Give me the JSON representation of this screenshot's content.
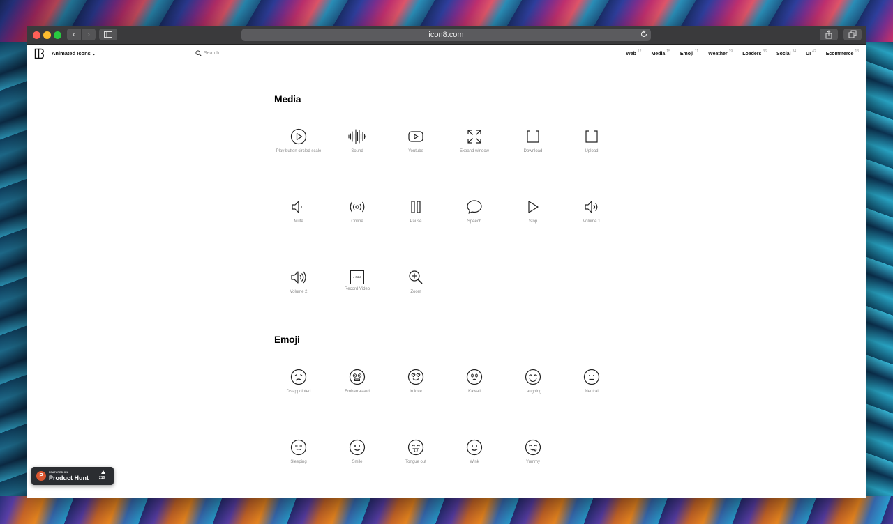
{
  "browser": {
    "url": "icon8.com"
  },
  "header": {
    "brand": "Animated Icons",
    "search_placeholder": "Search...",
    "categories": [
      {
        "label": "Web",
        "count": "12"
      },
      {
        "label": "Media",
        "count": "15"
      },
      {
        "label": "Emoji",
        "count": "11"
      },
      {
        "label": "Weather",
        "count": "19"
      },
      {
        "label": "Loaders",
        "count": "36"
      },
      {
        "label": "Social",
        "count": "34"
      },
      {
        "label": "UI",
        "count": "42"
      },
      {
        "label": "Ecommerce",
        "count": "13"
      }
    ]
  },
  "sections": {
    "media": {
      "title": "Media",
      "icons": [
        {
          "label": "Play button circled scale",
          "icon": "play-circle-icon"
        },
        {
          "label": "Sound",
          "icon": "sound-wave-icon"
        },
        {
          "label": "Youtube",
          "icon": "youtube-icon"
        },
        {
          "label": "Expand window",
          "icon": "expand-icon"
        },
        {
          "label": "Download",
          "icon": "download-icon"
        },
        {
          "label": "Upload",
          "icon": "upload-icon"
        },
        {
          "label": "Mute",
          "icon": "mute-icon"
        },
        {
          "label": "Online",
          "icon": "broadcast-icon"
        },
        {
          "label": "Pause",
          "icon": "pause-icon"
        },
        {
          "label": "Speech",
          "icon": "speech-bubble-icon"
        },
        {
          "label": "Stop",
          "icon": "play-triangle-icon"
        },
        {
          "label": "Volume 1",
          "icon": "volume-1-icon"
        },
        {
          "label": "Volume 2",
          "icon": "volume-2-icon"
        },
        {
          "label": "Record Video",
          "icon": "rec-icon",
          "badge": "● REC"
        },
        {
          "label": "Zoom",
          "icon": "zoom-in-icon"
        }
      ]
    },
    "emoji": {
      "title": "Emoji",
      "icons": [
        {
          "label": "Disappointed",
          "icon": "disappointed-face-icon"
        },
        {
          "label": "Embarrassed",
          "icon": "embarrassed-face-icon"
        },
        {
          "label": "In love",
          "icon": "in-love-face-icon"
        },
        {
          "label": "Kawaii",
          "icon": "kawaii-face-icon"
        },
        {
          "label": "Laughing",
          "icon": "laughing-face-icon"
        },
        {
          "label": "Neutral",
          "icon": "neutral-face-icon"
        },
        {
          "label": "Sleeping",
          "icon": "sleeping-face-icon"
        },
        {
          "label": "Smile",
          "icon": "smile-face-icon"
        },
        {
          "label": "Tongue out",
          "icon": "tongue-out-face-icon"
        },
        {
          "label": "Wink",
          "icon": "wink-face-icon"
        },
        {
          "label": "Yummy",
          "icon": "yummy-face-icon"
        }
      ]
    }
  },
  "product_hunt": {
    "featured": "FEATURED ON",
    "name": "Product Hunt",
    "upvotes": "210"
  },
  "colors": {
    "accent": "#da552f",
    "label_grey": "#8a8a8a"
  }
}
